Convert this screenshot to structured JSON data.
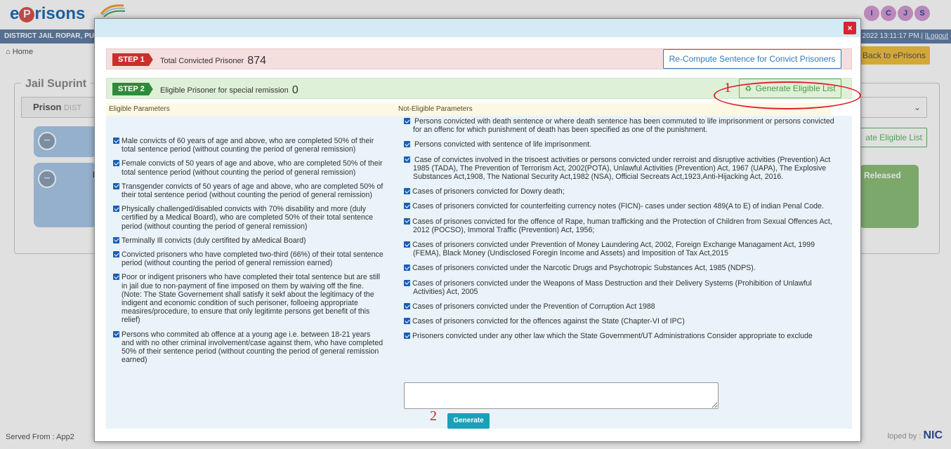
{
  "background": {
    "logo_prefix": "e",
    "logo_p": "P",
    "logo_suffix": "risons",
    "jail_name": "DISTRICT JAIL ROPAR, PU",
    "datetime_text": "2022 13:11:17 PM.| |",
    "logout_label": "Logout",
    "home_label": "Home",
    "back_label": "Back to ePrisons",
    "panel_title": "Jail Suprint",
    "prison_label": "Prison",
    "prison_value": "DIST",
    "card_label": "E",
    "gen_eligible_bg_label": "ate Eligible List",
    "released_label": "Released",
    "served_from": "Served From : App2",
    "developed_by": "loped by :",
    "nic_label": "NIC",
    "icjs_letters": [
      "I",
      "C",
      "J",
      "S"
    ]
  },
  "modal": {
    "close_label": "×",
    "step1": {
      "tag": "STEP 1",
      "text": "Total Convicted Prisoner",
      "count": "874",
      "button_label": "Re-Compute Sentence for Convict Prisoners"
    },
    "step2": {
      "tag": "STEP 2",
      "text": "Eligible Prisoner for special remission",
      "count": "0",
      "button_icon": "♻",
      "button_label": "Generate Eligible List"
    },
    "eligible_header": "Eligible Parameters",
    "not_eligible_header": "Not-Eligible Parameters",
    "eligible_params": [
      "Male convicts of 60 years of age and above, who are completed 50% of their total sentence period (without counting the period of general remission)",
      "Female convicts of 50 years of age and above, who are completed 50% of their total sentence period (without counting the period of general remission)",
      "Transgender convicts of 50 years of age and above, who are completed 50% of their total sentence period (without counting the period of general remission)",
      "Physically challenged/disabled convicts with 70% disability and more (duly certified by a Medical Board), who are completed 50% of their total sentence period (without counting the period of general remission)",
      "Terminally Ill convicts (duly certifited by aMedical Board)",
      "Convicted prisoners who have completed two-third (66%) of their total sentence period (without counting the period of general remission earned)",
      "Poor or indigent prisoners who have completed their total sentence but are still in jail due to non-payment of fine imposed on them by waiving off the fine. (Note: The State Governement shall satisfy it sekf about the legitimacy of the indigent and economic condition of such perisoner, folloeing appropriate measires/procedure, to ensure that only legitimte persons get benefit of this relief)",
      "Persons who commited ab offence at a young age i.e. between 18-21 years and with no other criminal involvement/case against them, who have completed 50% of their sentence period (without counting the period of general remission earned)"
    ],
    "not_eligible_params": [
      " Persons convicted with death sentence or where death sentence has been commuted to life imprisonment or persons convicted for an offenc for which punishment of death has been specified as one of the punishment.",
      " Persons convicted with sentence of life imprisonment.",
      " Case of convictes involved in the trisoest activities or persons convicted under rerroist and disruptive activities (Prevention) Act 1985 (TADA), The Prevention of Terrorism Act, 2002(POTA), Unlawful Activities (Prevention) Act, 1967 (UAPA), The Explosive Substances Act,1908, The National Security Act,1982 (NSA), Official Secreats Act,1923,Anti-Hijacking Act, 2016.",
      "Cases of prisoners convicted for Dowry death;",
      "Cases of prisoners convicted for counterfeiting currency notes (FICN)- cases under section 489(A to E) of indian Penal Code.",
      "Cases of prisones convicted for the offence of Rape, human trafficking and the Protection of Children from Sexual Offences Act, 2012 (POCSO), Immoral Traffic (Prevention) Act, 1956;",
      "Cases of prisoners convicted under Prevention of Money Laundering Act, 2002, Foreign Exchange Managament Act, 1999 (FEMA), Black Money (Undisclosed Foregin Income and Assets) and Imposition of Tax Act,2015",
      "Cases of prisoners convicted under the Narcotic Drugs and Psychotropic Substances Act, 1985 (NDPS).",
      "Cases of prisoners convicted under the Weapons of Mass Destruction and their Delivery Systems (Prohibition of Unlawful Activities) Act, 2005",
      "Cases of prisoners convicted under the Prevention of Corruption Act 1988",
      "Cases of prisoners convicted for the offences against the State (Chapter-VI of IPC)",
      "Prisoners convicted under any other law which the State Government/UT Administrations Consider appropriate to exclude"
    ],
    "remarks_value": "",
    "generate_label": "Generate"
  },
  "annotations": {
    "marker_1": "1",
    "marker_2": "2",
    "color": "#d8202a"
  }
}
